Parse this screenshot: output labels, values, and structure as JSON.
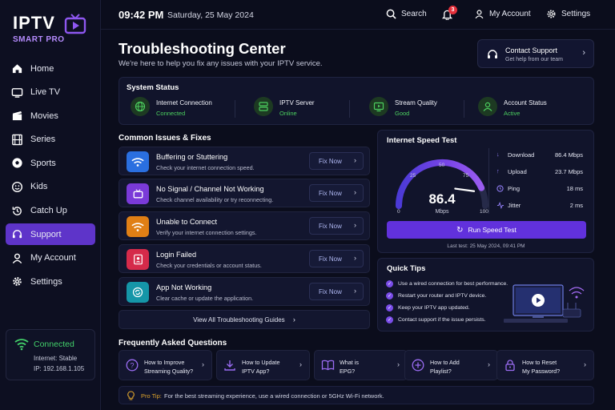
{
  "brand": {
    "name": "IPTV",
    "tagline": "SMART PRO",
    "accent": "#6131dc"
  },
  "sidebar": {
    "items": [
      {
        "label": "Home",
        "icon": "home-icon"
      },
      {
        "label": "Live TV",
        "icon": "tv-icon"
      },
      {
        "label": "Movies",
        "icon": "clapperboard-icon"
      },
      {
        "label": "Series",
        "icon": "film-icon"
      },
      {
        "label": "Sports",
        "icon": "ball-icon"
      },
      {
        "label": "Kids",
        "icon": "smile-icon"
      },
      {
        "label": "Catch Up",
        "icon": "history-icon"
      },
      {
        "label": "Support",
        "icon": "headset-icon",
        "active": true
      },
      {
        "label": "My Account",
        "icon": "user-icon"
      },
      {
        "label": "Settings",
        "icon": "gear-icon"
      }
    ],
    "connection": {
      "title": "Connected",
      "internet": "Internet: Stable",
      "ip": "IP: 192.168.1.105"
    }
  },
  "topbar": {
    "time": "09:42 PM",
    "date": "Saturday, 25 May 2024",
    "search_label": "Search",
    "notifications_count": "3",
    "account_label": "My Account",
    "settings_label": "Settings"
  },
  "header": {
    "title": "Troubleshooting Center",
    "subtitle": "We're here to help you fix any issues with your IPTV service.",
    "contact_title": "Contact Support",
    "contact_sub": "Get help from our team"
  },
  "system_status": {
    "title": "System Status",
    "items": [
      {
        "name": "Internet Connection",
        "value": "Connected",
        "icon": "globe-icon"
      },
      {
        "name": "IPTV Server",
        "value": "Online",
        "icon": "server-icon"
      },
      {
        "name": "Stream Quality",
        "value": "Good",
        "icon": "monitor-play-icon"
      },
      {
        "name": "Account Status",
        "value": "Active",
        "icon": "user-check-icon"
      }
    ]
  },
  "issues": {
    "title": "Common Issues & Fixes",
    "button_label": "Fix Now",
    "items": [
      {
        "title": "Buffering or Stuttering",
        "desc": "Check your internet connection speed.",
        "icon": "wifi-icon",
        "color": "#2a6fe0"
      },
      {
        "title": "No Signal / Channel Not Working",
        "desc": "Check channel availability or try reconnecting.",
        "icon": "tv-icon",
        "color": "#7a3ad8"
      },
      {
        "title": "Unable to Connect",
        "desc": "Verify your internet connection settings.",
        "icon": "wifi-icon",
        "color": "#e07f15"
      },
      {
        "title": "Login Failed",
        "desc": "Check your credentials or account status.",
        "icon": "user-card-icon",
        "color": "#d52a4a"
      },
      {
        "title": "App Not Working",
        "desc": "Clear cache or update the application.",
        "icon": "refresh-icon",
        "color": "#1596a8"
      }
    ],
    "view_all": "View All Troubleshooting Guides"
  },
  "speed_test": {
    "title": "Internet Speed Test",
    "value": "86.4",
    "unit": "Mbps",
    "gauge_max": 100,
    "gauge_ticks": [
      "0",
      "25",
      "50",
      "75",
      "100"
    ],
    "metrics": [
      {
        "label": "Download",
        "value": "86.4 Mbps",
        "icon": "arrow-down-icon"
      },
      {
        "label": "Upload",
        "value": "23.7 Mbps",
        "icon": "arrow-up-icon"
      },
      {
        "label": "Ping",
        "value": "18 ms",
        "icon": "clock-icon"
      },
      {
        "label": "Jitter",
        "value": "2 ms",
        "icon": "wave-icon"
      }
    ],
    "run_label": "Run Speed Test",
    "last_test": "Last test: 25 May 2024, 09:41 PM"
  },
  "quick_tips": {
    "title": "Quick Tips",
    "items": [
      "Use a wired connection for best performance.",
      "Restart your router and IPTV device.",
      "Keep your IPTV app updated.",
      "Contact support if the issue persists."
    ]
  },
  "faq": {
    "title": "Frequently Asked Questions",
    "items": [
      {
        "line1": "How to Improve",
        "line2": "Streaming Quality?",
        "icon": "question-icon"
      },
      {
        "line1": "How to Update",
        "line2": "IPTV App?",
        "icon": "download-icon"
      },
      {
        "line1": "What is",
        "line2": "EPG?",
        "icon": "book-icon"
      },
      {
        "line1": "How to Add",
        "line2": "Playlist?",
        "icon": "plus-circle-icon"
      },
      {
        "line1": "How to Reset",
        "line2": "My Password?",
        "icon": "lock-icon"
      }
    ]
  },
  "pro_tip": {
    "label": "Pro Tip:",
    "text": "For the best streaming experience, use a wired connection or 5GHz Wi-Fi network."
  }
}
